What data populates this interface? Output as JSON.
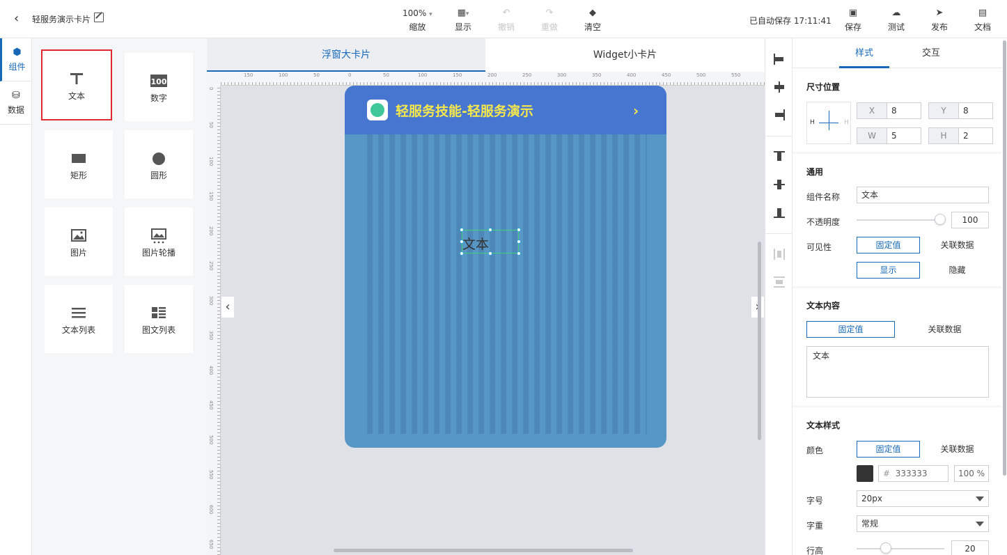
{
  "header": {
    "title": "轻服务演示卡片",
    "toolbar": {
      "zoom_value": "100%",
      "zoom_label": "缩放",
      "display_label": "显示",
      "undo_label": "撤销",
      "redo_label": "重做",
      "clear_label": "清空"
    },
    "autosave": "已自动保存 17:11:41",
    "actions": {
      "save": "保存",
      "test": "测试",
      "publish": "发布",
      "docs": "文档"
    }
  },
  "leftnav": {
    "components": "组件",
    "data": "数据"
  },
  "palette": {
    "items": [
      {
        "label": "文本",
        "icon": "text-icon"
      },
      {
        "label": "数字",
        "icon": "number-icon"
      },
      {
        "label": "矩形",
        "icon": "rectangle-icon"
      },
      {
        "label": "圆形",
        "icon": "circle-icon"
      },
      {
        "label": "图片",
        "icon": "image-icon"
      },
      {
        "label": "图片轮播",
        "icon": "carousel-icon"
      },
      {
        "label": "文本列表",
        "icon": "list-icon"
      },
      {
        "label": "图文列表",
        "icon": "image-list-icon"
      }
    ]
  },
  "canvas": {
    "tabs": [
      "浮窗大卡片",
      "Widget小卡片"
    ],
    "ruler_h": [
      "150",
      "100",
      "50",
      "0",
      "50",
      "100",
      "150",
      "200",
      "250",
      "300",
      "350",
      "400",
      "450",
      "500",
      "550"
    ],
    "ruler_v": [
      "0",
      "50",
      "100",
      "150",
      "200",
      "250",
      "300",
      "350",
      "400",
      "450",
      "500",
      "550",
      "600",
      "650"
    ],
    "card": {
      "title": "轻服务技能-轻服务演示",
      "arrow": "›",
      "selected_text": "文本"
    }
  },
  "panel": {
    "tabs": [
      "样式",
      "交互"
    ],
    "size_position": {
      "title": "尺寸位置",
      "x_label": "X",
      "x": "8",
      "y_label": "Y",
      "y": "8",
      "w_label": "W",
      "w": "5",
      "h_label": "H",
      "h": "2",
      "anchor_h": "H",
      "anchor_h_right": "H"
    },
    "general": {
      "title": "通用",
      "name_label": "组件名称",
      "name_value": "文本",
      "opacity_label": "不透明度",
      "opacity_value": "100",
      "opacity_fraction": 1.0,
      "visibility_label": "可见性",
      "fixed": "固定值",
      "bind": "关联数据",
      "show": "显示",
      "hide": "隐藏"
    },
    "text_content": {
      "title": "文本内容",
      "fixed": "固定值",
      "bind": "关联数据",
      "value": "文本"
    },
    "text_style": {
      "title": "文本样式",
      "color_label": "颜色",
      "fixed": "固定值",
      "bind": "关联数据",
      "color_hash": "#",
      "color_hex": "333333",
      "color_swatch": "#333333",
      "color_alpha": "100 %",
      "size_label": "字号",
      "size_value": "20px",
      "weight_label": "字重",
      "weight_value": "常规",
      "lineheight_label": "行高",
      "lineheight_value": "20"
    }
  },
  "colors": {
    "accent": "#1769b8",
    "card_header": "#4776d1",
    "card_body": "#5797c5",
    "card_title": "#f5e74c",
    "selection": "#3fd07a"
  }
}
